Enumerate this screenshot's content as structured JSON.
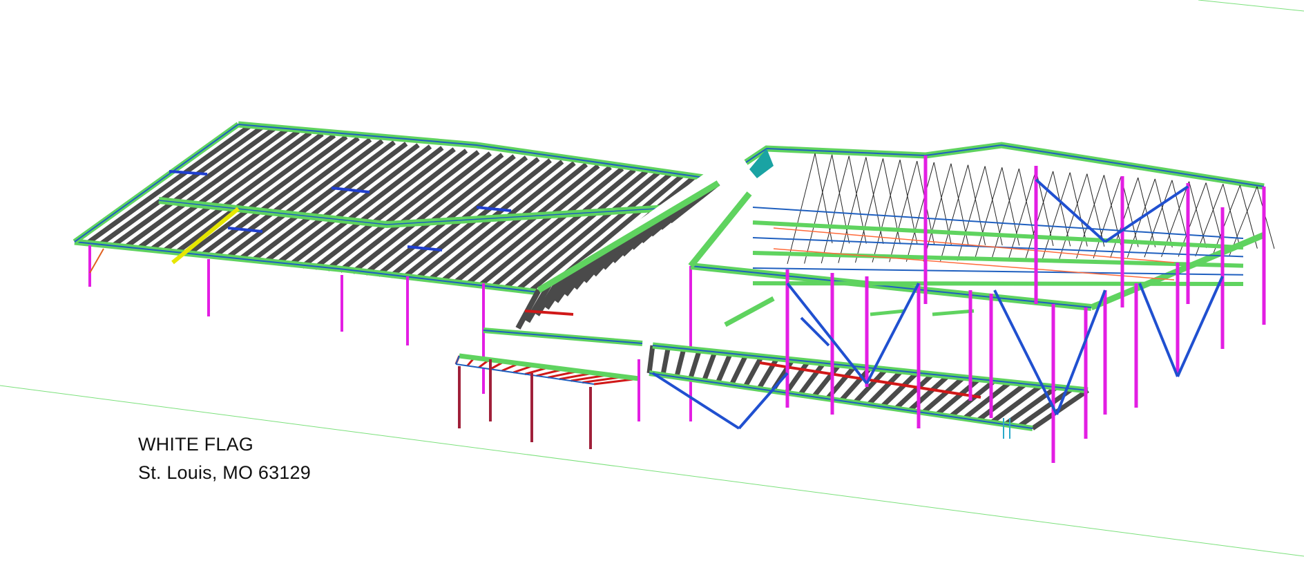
{
  "view": {
    "type": "3D structural steel model view"
  },
  "labels": {
    "project_name": "WHITE FLAG",
    "project_location": "St. Louis, MO 63129"
  },
  "colors": {
    "background": "#ffffff",
    "beams": "#5fd35f",
    "beam_edge": "#1f5fbf",
    "columns": "#e31ee3",
    "braces": "#2050d0",
    "joists": "#4a4a4a",
    "red_members": "#d01818",
    "dark_columns": "#a0203a",
    "yellow_member": "#e6e600",
    "teal_member": "#1aa3a3",
    "grid_line": "#7be07b",
    "label_text": "#111111"
  }
}
